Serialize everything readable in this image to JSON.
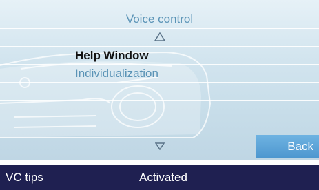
{
  "screen": {
    "title": "Voice control",
    "menu": {
      "items": [
        {
          "label": "Help Window",
          "selected": true
        },
        {
          "label": "Individualization",
          "selected": false
        }
      ]
    },
    "back_label": "Back"
  },
  "bottom_bar": {
    "left_label": "VC tips",
    "status": "Activated"
  },
  "colors": {
    "accent_text": "#5a93b6",
    "button": "#4d97cf",
    "bottom_bar": "#1f2051"
  },
  "icons": [
    "arrow-up-icon",
    "arrow-down-icon",
    "car-silhouette"
  ]
}
